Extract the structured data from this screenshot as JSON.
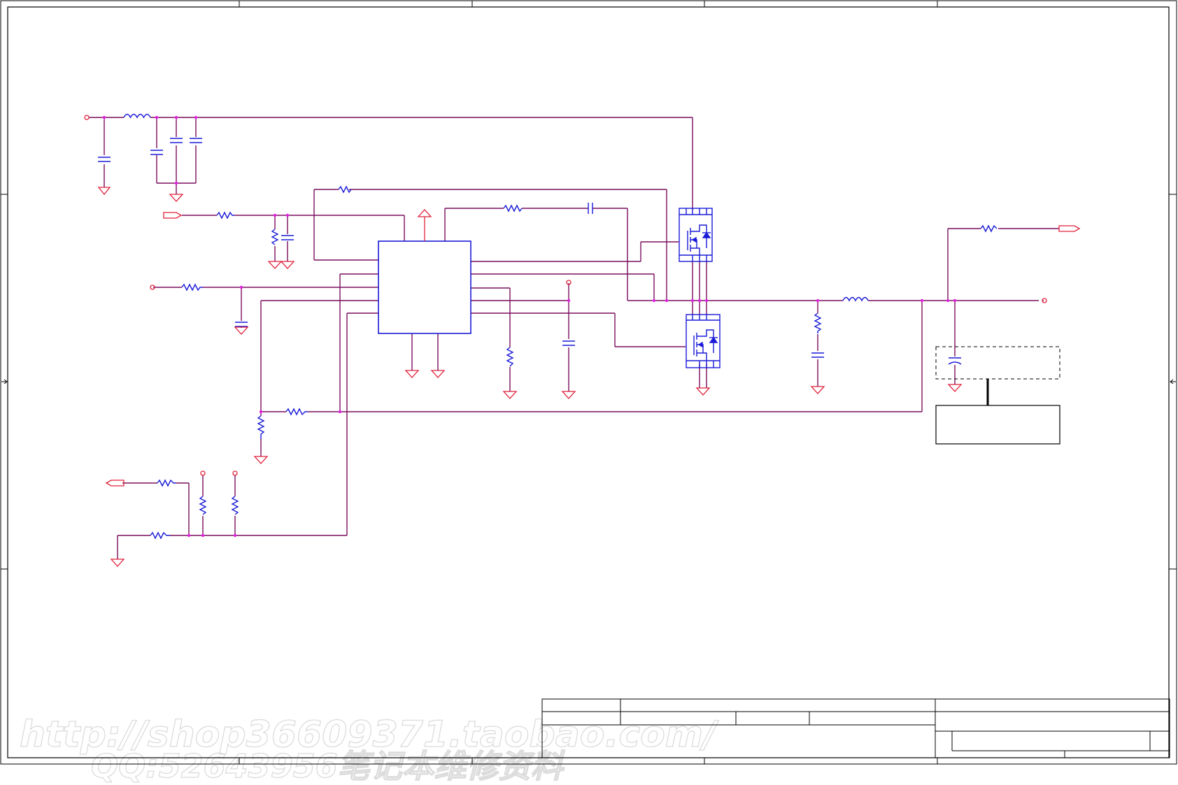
{
  "watermark": {
    "line1": "http://shop36609371.taobao.com/",
    "line2": "QQ:52643956笔记本维修资料"
  },
  "colors": {
    "wire": "#7a0e5e",
    "ground_and_ports": "#e0203a",
    "components": "#1a1ad8",
    "junction": "#e020e0"
  }
}
